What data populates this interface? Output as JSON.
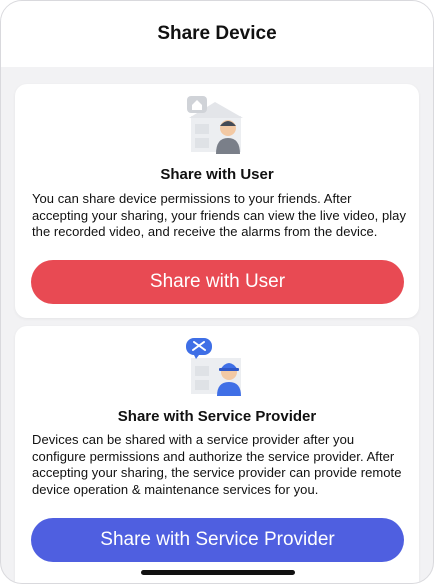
{
  "header": {
    "title": "Share Device"
  },
  "share_user": {
    "title": "Share with User",
    "description": "You can share device permissions to your friends. After accepting your sharing, your friends can view the live video, play the recorded video, and receive the alarms from the device.",
    "button_label": "Share with User",
    "button_color": "#e84a53"
  },
  "share_provider": {
    "title": "Share with Service Provider",
    "description": "Devices can be shared with a service provider after you configure permissions and authorize the service provider. After accepting your sharing, the service provider can provide remote device operation & maintenance services for you.",
    "button_label": "Share with Service Provider",
    "button_color": "#4f5fe0"
  }
}
